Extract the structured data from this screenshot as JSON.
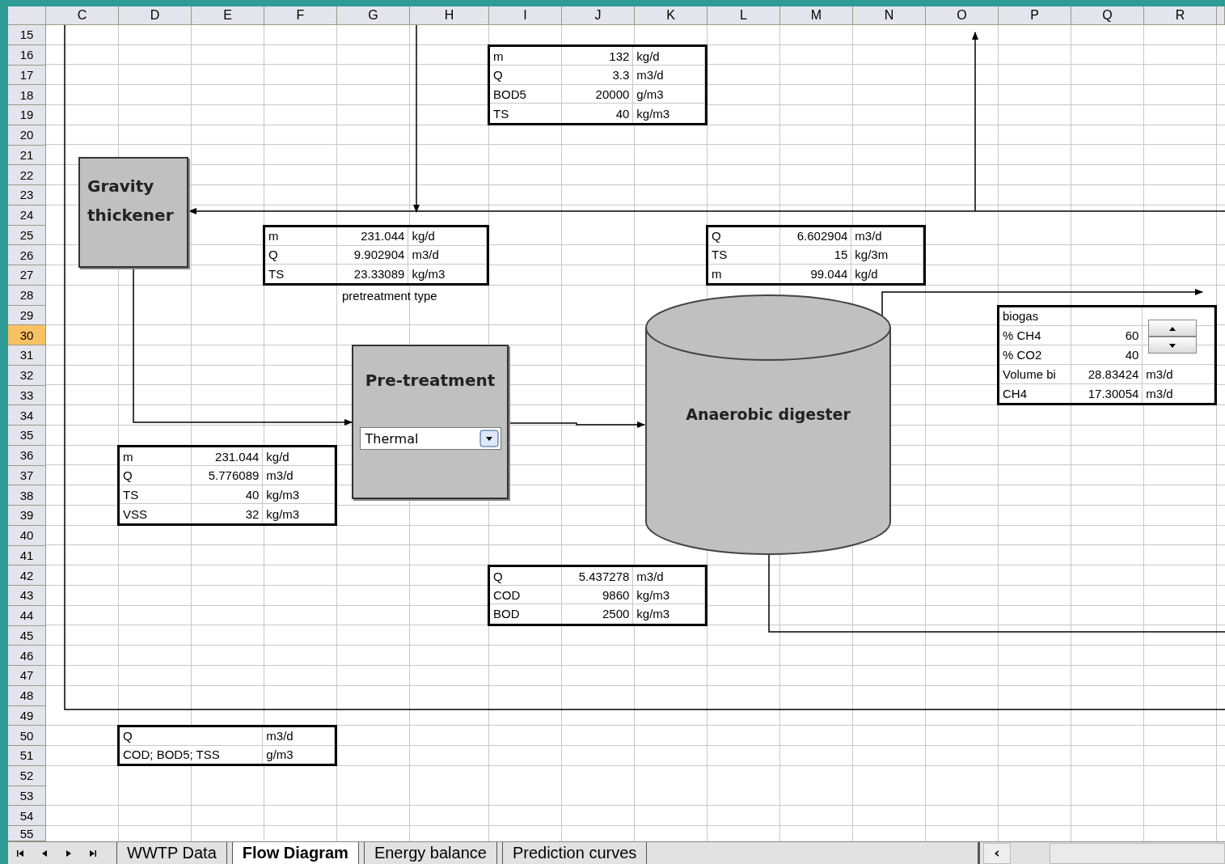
{
  "columns": [
    "C",
    "D",
    "E",
    "F",
    "G",
    "H",
    "I",
    "J",
    "K",
    "L",
    "M",
    "N",
    "O",
    "P",
    "Q",
    "R"
  ],
  "rows": [
    {
      "label": "15",
      "selected": false
    },
    {
      "label": "16",
      "selected": false
    },
    {
      "label": "17",
      "selected": false
    },
    {
      "label": "18",
      "selected": false
    },
    {
      "label": "19",
      "selected": false
    },
    {
      "label": "20",
      "selected": false
    },
    {
      "label": "21",
      "selected": false
    },
    {
      "label": "22",
      "selected": false
    },
    {
      "label": "23",
      "selected": false
    },
    {
      "label": "24",
      "selected": false
    },
    {
      "label": "25",
      "selected": false
    },
    {
      "label": "26",
      "selected": false
    },
    {
      "label": "27",
      "selected": false
    },
    {
      "label": "28",
      "selected": false
    },
    {
      "label": "29",
      "selected": false
    },
    {
      "label": "30",
      "selected": true
    },
    {
      "label": "31",
      "selected": false
    },
    {
      "label": "32",
      "selected": false
    },
    {
      "label": "33",
      "selected": false
    },
    {
      "label": "34",
      "selected": false
    },
    {
      "label": "35",
      "selected": false
    },
    {
      "label": "36",
      "selected": false
    },
    {
      "label": "37",
      "selected": false
    },
    {
      "label": "38",
      "selected": false
    },
    {
      "label": "39",
      "selected": false
    },
    {
      "label": "40",
      "selected": false
    },
    {
      "label": "41",
      "selected": false
    },
    {
      "label": "42",
      "selected": false
    },
    {
      "label": "43",
      "selected": false
    },
    {
      "label": "44",
      "selected": false
    },
    {
      "label": "45",
      "selected": false
    },
    {
      "label": "46",
      "selected": false
    },
    {
      "label": "47",
      "selected": false
    },
    {
      "label": "48",
      "selected": false
    },
    {
      "label": "49",
      "selected": false
    },
    {
      "label": "50",
      "selected": false
    },
    {
      "label": "51",
      "selected": false
    },
    {
      "label": "52",
      "selected": false
    },
    {
      "label": "53",
      "selected": false
    },
    {
      "label": "54",
      "selected": false
    },
    {
      "label": "55",
      "selected": false
    }
  ],
  "units": [
    {
      "kind": "box",
      "label": "Gravity thickener"
    },
    {
      "kind": "box",
      "label": "Pre-treatment",
      "dropdown": {
        "value": "Thermal"
      }
    },
    {
      "kind": "tank",
      "label": "Anaerobic digester"
    }
  ],
  "note": "pretreatment type",
  "tables": [
    {
      "rows": [
        {
          "label": "m",
          "value": "132",
          "unit": "kg/d"
        },
        {
          "label": "Q",
          "value": "3.3",
          "unit": "m3/d"
        },
        {
          "label": "BOD5",
          "value": "20000",
          "unit": "g/m3"
        },
        {
          "label": "TS",
          "value": "40",
          "unit": "kg/m3"
        }
      ]
    },
    {
      "rows": [
        {
          "label": "m",
          "value": "231.044",
          "unit": "kg/d"
        },
        {
          "label": "Q",
          "value": "9.902904",
          "unit": "m3/d"
        },
        {
          "label": "TS",
          "value": "23.33089",
          "unit": "kg/m3"
        }
      ]
    },
    {
      "rows": [
        {
          "label": "Q",
          "value": "6.602904",
          "unit": "m3/d"
        },
        {
          "label": "TS",
          "value": "15",
          "unit": "kg/3m"
        },
        {
          "label": "m",
          "value": "99.044",
          "unit": "kg/d"
        }
      ]
    },
    {
      "rows": [
        {
          "label": "biogas"
        },
        {
          "label": "% CH4",
          "value": "60"
        },
        {
          "label": "% CO2",
          "value": "40"
        },
        {
          "label": "Volume bi",
          "value": "28.83424",
          "unit": "m3/d"
        },
        {
          "label": "CH4",
          "value": "17.30054",
          "unit": "m3/d"
        }
      ]
    },
    {
      "rows": [
        {
          "label": "m",
          "value": "231.044",
          "unit": "kg/d"
        },
        {
          "label": "Q",
          "value": "5.776089",
          "unit": "m3/d"
        },
        {
          "label": "TS",
          "value": "40",
          "unit": "kg/m3"
        },
        {
          "label": "VSS",
          "value": "32",
          "unit": "kg/m3"
        }
      ]
    },
    {
      "rows": [
        {
          "label": "Q",
          "value": "5.437278",
          "unit": "m3/d"
        },
        {
          "label": "COD",
          "value": "9860",
          "unit": "kg/m3"
        },
        {
          "label": "BOD",
          "value": "2500",
          "unit": "kg/m3"
        }
      ]
    },
    {
      "rows": [
        {
          "label": "Q",
          "unit": "m3/d"
        },
        {
          "label": "COD; BOD5; TSS",
          "unit": "g/m3"
        }
      ]
    }
  ],
  "sheet_tabs": [
    {
      "label": "WWTP Data",
      "selected": false
    },
    {
      "label": "Flow Diagram",
      "selected": true
    },
    {
      "label": "Energy balance",
      "selected": false
    },
    {
      "label": "Prediction curves",
      "selected": false
    }
  ]
}
